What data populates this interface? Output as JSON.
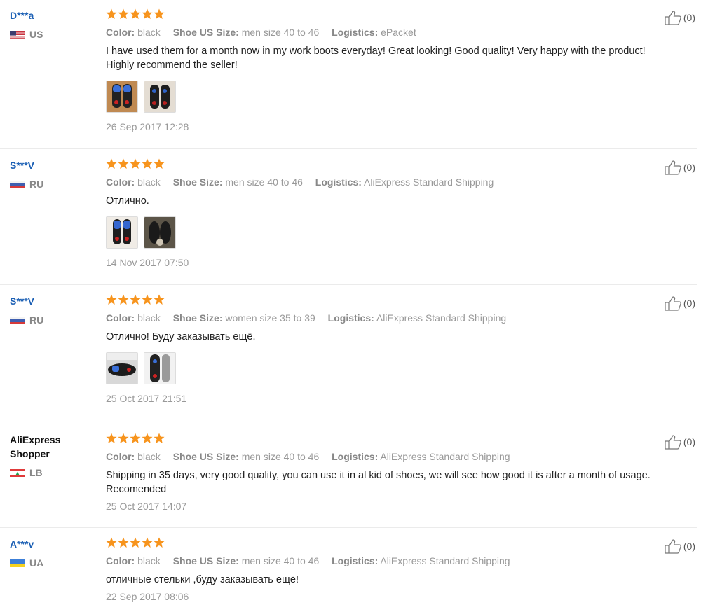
{
  "labels": {
    "color": "Color:",
    "shoe_us_size": "Shoe US Size:",
    "shoe_size": "Shoe Size:",
    "logistics": "Logistics:"
  },
  "colors": {
    "star": "#f7941d",
    "buyer_link": "#1b5fb4",
    "muted": "#999999"
  },
  "reviews": [
    {
      "buyer": "D***a",
      "country": "US",
      "rating": 5,
      "size_label": "Shoe US Size:",
      "color": "black",
      "size": "men size 40 to 46",
      "logistics": "ePacket",
      "feedback": "I have used them for a month now in my work boots everyday! Great looking! Good quality! Very happy with the product! Highly recommend the seller!",
      "photos": [
        "insole-photo",
        "insole-photo"
      ],
      "date": "26 Sep 2017 12:28",
      "helpful": "(0)"
    },
    {
      "buyer": "S***V",
      "country": "RU",
      "rating": 5,
      "size_label": "Shoe Size:",
      "color": "black",
      "size": "men size 40 to 46",
      "logistics": "AliExpress Standard Shipping",
      "feedback": "Отлично.",
      "photos": [
        "insole-photo",
        "insole-photo"
      ],
      "date": "14 Nov 2017 07:50",
      "helpful": "(0)"
    },
    {
      "buyer": "S***V",
      "country": "RU",
      "rating": 5,
      "size_label": "Shoe Size:",
      "color": "black",
      "size": "women size 35 to 39",
      "logistics": "AliExpress Standard Shipping",
      "feedback": "Отлично! Буду заказывать ещё.",
      "photos": [
        "insole-photo",
        "insole-photo"
      ],
      "date": "25 Oct 2017 21:51",
      "helpful": "(0)"
    },
    {
      "buyer": "AliExpress\nShopper",
      "country": "LB",
      "rating": 5,
      "size_label": "Shoe US Size:",
      "color": "black",
      "size": "men size 40 to 46",
      "logistics": "AliExpress Standard Shipping",
      "feedback": "Shipping in 35 days, very good quality, you can use it in al kid of shoes, we will see how good it is after a month of usage. Recomended",
      "photos": [],
      "date": "25 Oct 2017 14:07",
      "helpful": "(0)"
    },
    {
      "buyer": "A***v",
      "country": "UA",
      "rating": 5,
      "size_label": "Shoe US Size:",
      "color": "black",
      "size": "men size 40 to 46",
      "logistics": "AliExpress Standard Shipping",
      "feedback": "отличные стельки ,буду заказывать ещё!",
      "photos": [],
      "date": "22 Sep 2017 08:06",
      "helpful": "(0)"
    }
  ]
}
